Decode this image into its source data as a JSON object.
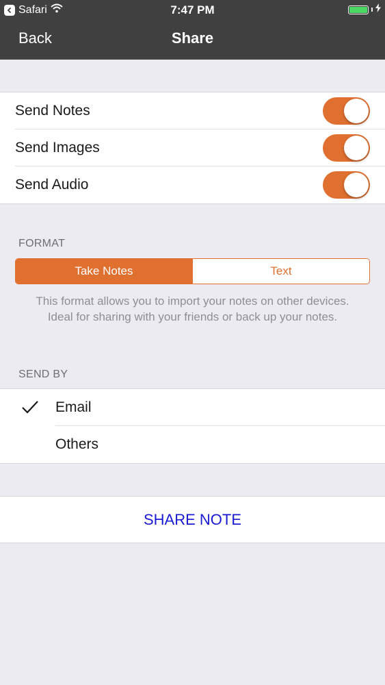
{
  "status_bar": {
    "back_app": "Safari",
    "time": "7:47 PM"
  },
  "nav": {
    "back_label": "Back",
    "title": "Share"
  },
  "toggles": [
    {
      "label": "Send Notes",
      "on": true
    },
    {
      "label": "Send Images",
      "on": true
    },
    {
      "label": "Send Audio",
      "on": true
    }
  ],
  "format": {
    "header": "FORMAT",
    "options": [
      "Take Notes",
      "Text"
    ],
    "selected": "Take Notes",
    "description_line1": "This format allows you to import your notes on other devices.",
    "description_line2": "Ideal for sharing with your friends or back up your notes."
  },
  "send_by": {
    "header": "SEND BY",
    "options": [
      {
        "label": "Email",
        "checked": true
      },
      {
        "label": "Others",
        "checked": false
      }
    ]
  },
  "share_button": {
    "label": "SHARE NOTE"
  },
  "colors": {
    "accent": "#e07030",
    "nav_background": "#404040",
    "share_text": "#1a1ad2",
    "background": "#ebebf1"
  }
}
